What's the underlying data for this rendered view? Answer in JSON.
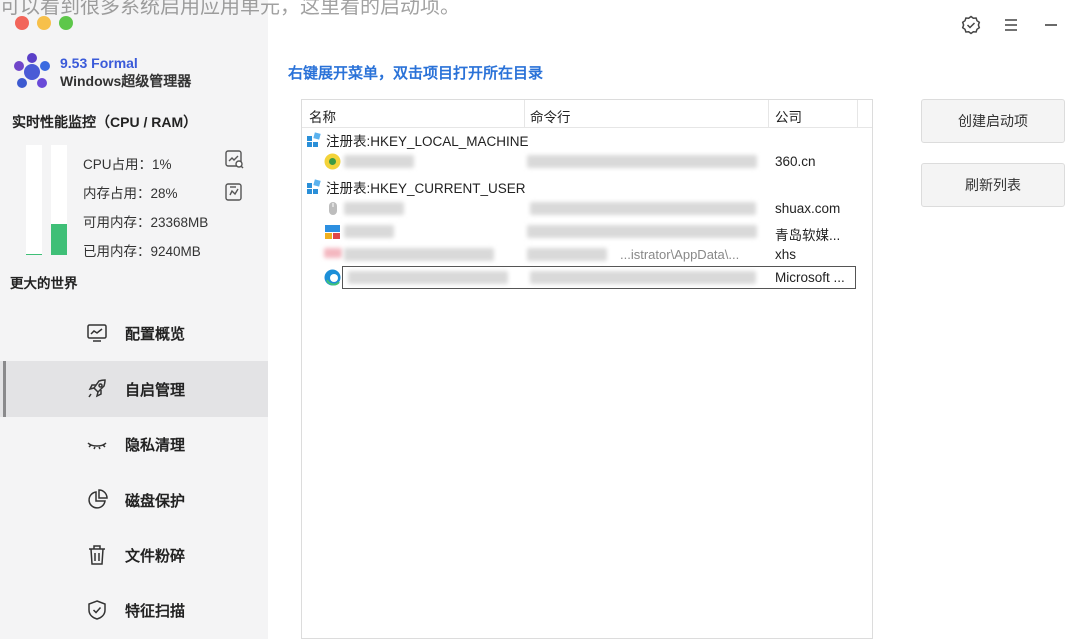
{
  "background_text": "可以看到很多系统启用应用单元，这里看的启动项。",
  "window": {
    "controls": [
      "badge-check-icon",
      "menu-icon",
      "minimize-icon"
    ]
  },
  "brand": {
    "version": "9.53 Formal",
    "name": "Windows超级管理器"
  },
  "monitor": {
    "title": "实时性能监控（CPU / RAM）",
    "cpu_label": "CPU占用：1%",
    "mem_label": "内存占用：28%",
    "avail_label": "可用内存：23368MB",
    "used_label": "已用内存：9240MB",
    "cpu_fraction": 0.01,
    "mem_fraction": 0.28,
    "bar_color": "#3fbf77"
  },
  "tagline": "更大的世界",
  "nav": [
    {
      "label": "配置概览",
      "icon": "monitor-chart-icon"
    },
    {
      "label": "自启管理",
      "icon": "rocket-icon",
      "active": true
    },
    {
      "label": "隐私清理",
      "icon": "closed-eye-icon"
    },
    {
      "label": "磁盘保护",
      "icon": "pie-chart-icon"
    },
    {
      "label": "文件粉碎",
      "icon": "trash-icon"
    },
    {
      "label": "特征扫描",
      "icon": "shield-check-icon"
    }
  ],
  "hint": "右键展开菜单，双击项目打开所在目录",
  "table": {
    "headers": {
      "name": "名称",
      "command": "命令行",
      "company": "公司"
    },
    "groups": [
      {
        "label": "注册表:HKEY_LOCAL_MACHINE"
      },
      {
        "label": "注册表:HKEY_CURRENT_USER"
      }
    ],
    "rows": [
      {
        "company": "360.cn",
        "command": ""
      },
      {
        "company": "shuax.com",
        "command": ""
      },
      {
        "company": "青岛软媒...",
        "command": "...istrator\\AppData\\..."
      },
      {
        "company": "xhs",
        "command": ""
      },
      {
        "company": "Microsoft ...",
        "command": ""
      }
    ]
  },
  "actions": {
    "create": "创建启动项",
    "refresh": "刷新列表"
  },
  "accent": "#2a72d8"
}
